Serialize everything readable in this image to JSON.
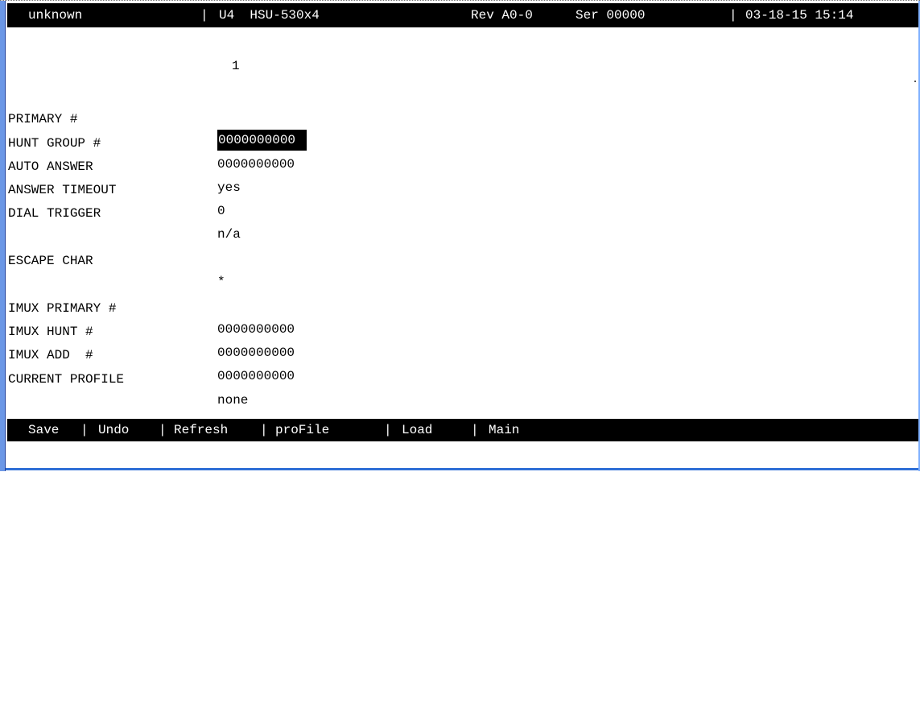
{
  "header": {
    "device_name": "unknown",
    "unit_model": "U4  HSU-530x4",
    "rev": "Rev A0-0",
    "serial": "Ser 00000",
    "datetime": "03-18-15 15:14"
  },
  "column_index": "1",
  "fields": [
    {
      "label": "PRIMARY #",
      "value": "0000000000"
    },
    {
      "label": "HUNT GROUP #",
      "value": "0000000000"
    },
    {
      "label": "AUTO ANSWER",
      "value": "yes"
    },
    {
      "label": "ANSWER TIMEOUT",
      "value": "0"
    },
    {
      "label": "DIAL TRIGGER",
      "value": "n/a"
    },
    {
      "label": "ESCAPE CHAR",
      "value": "*"
    },
    {
      "label": "IMUX PRIMARY #",
      "value": "0000000000"
    },
    {
      "label": "IMUX HUNT #",
      "value": "0000000000"
    },
    {
      "label": "IMUX ADD  #",
      "value": "0000000000"
    },
    {
      "label": "CURRENT PROFILE",
      "value": "none"
    }
  ],
  "menu": {
    "save": "Save",
    "undo": "Undo",
    "refresh": "Refresh",
    "profile": "proFile",
    "load": "Load",
    "main": "Main",
    "separator": "|"
  },
  "colors": {
    "header_bg": "#000000",
    "header_fg": "#ffffff",
    "selection_bg": "#000000",
    "window_frame": "#6b97e6"
  }
}
